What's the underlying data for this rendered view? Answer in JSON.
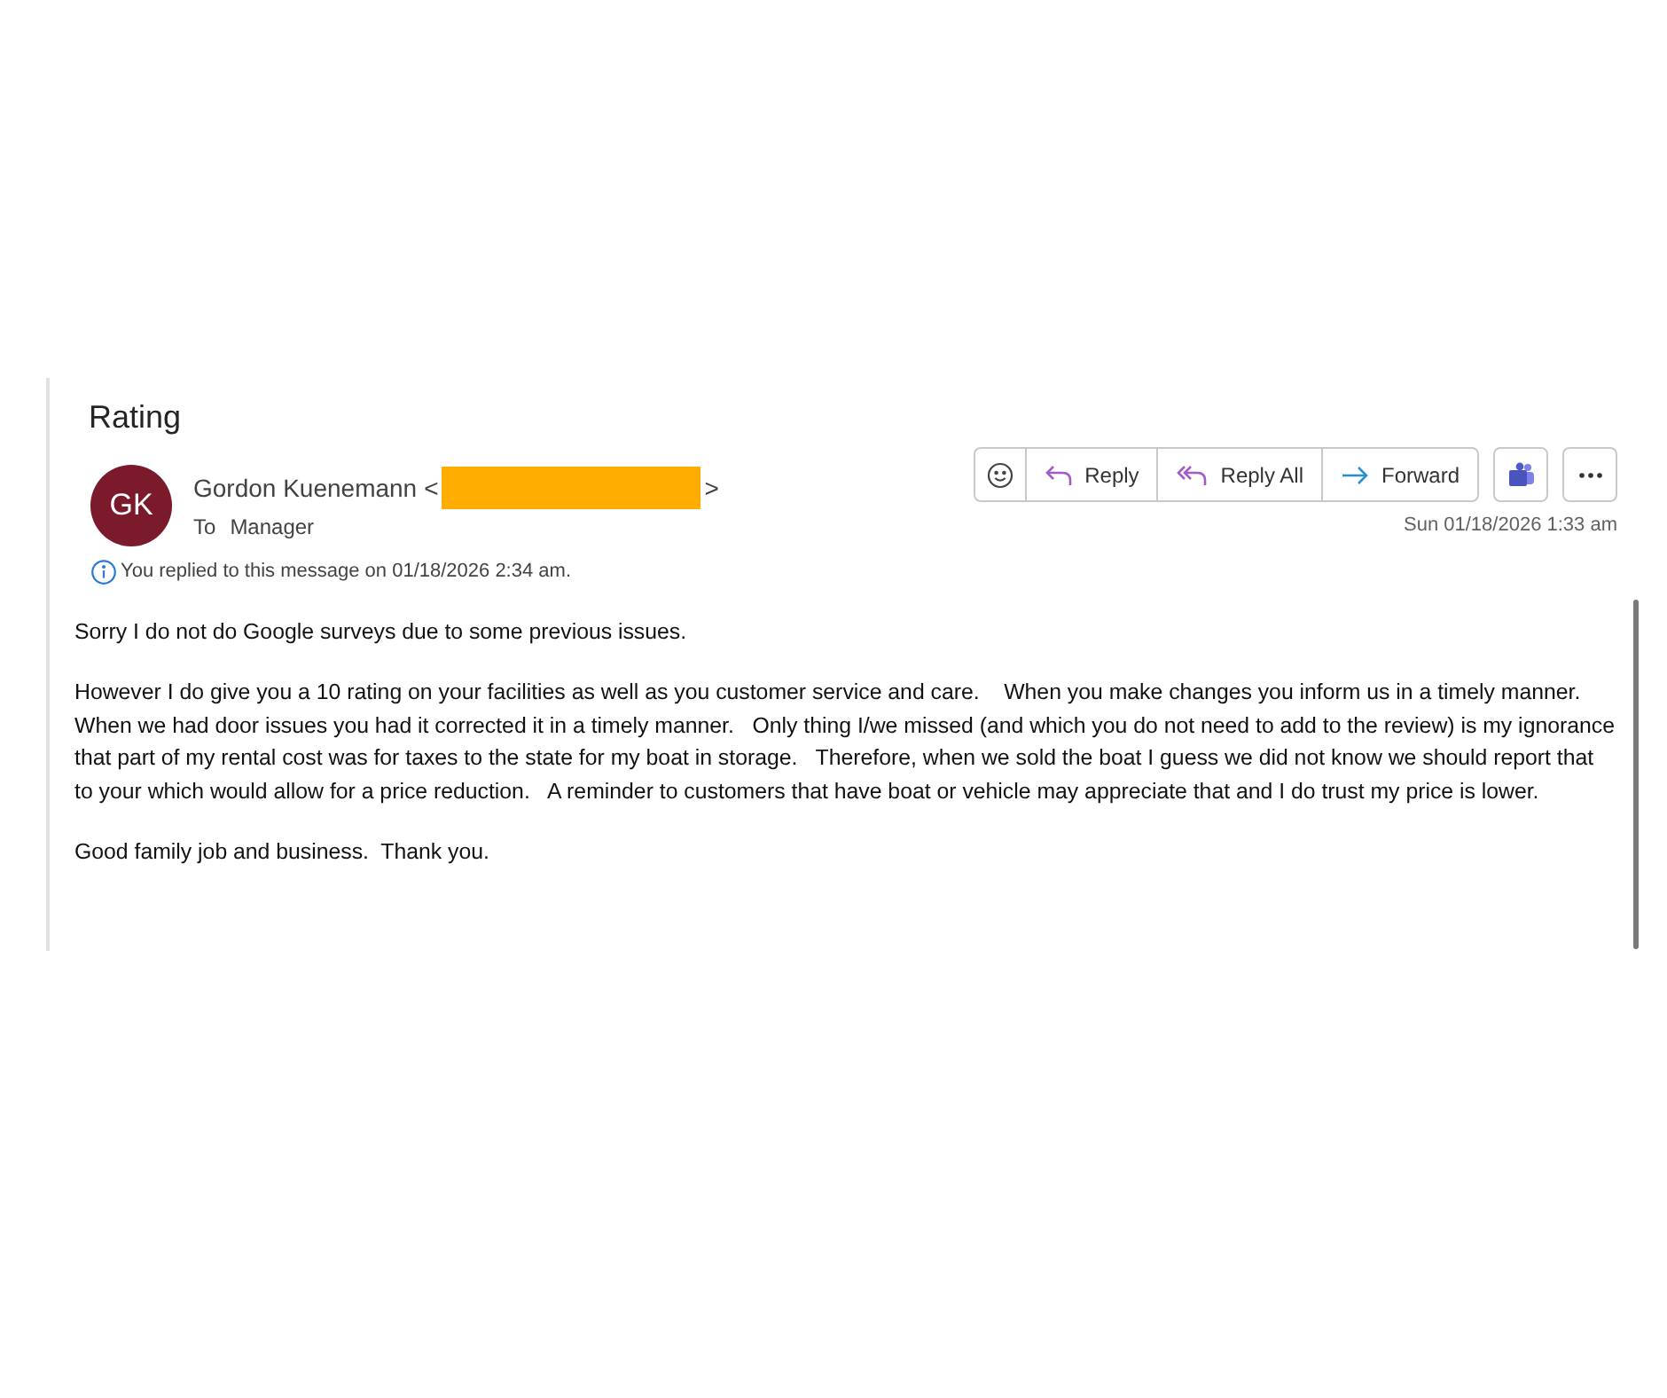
{
  "subject": "Rating",
  "sender": {
    "initials": "GK",
    "name": "Gordon Kuenemann",
    "open_bracket": "<",
    "close_bracket": ">",
    "address_redacted": true
  },
  "recipients": {
    "label": "To",
    "names": "Manager"
  },
  "info": "You replied to this message on 01/18/2026 2:34 am.",
  "actions": [
    {
      "kind": "emoji"
    },
    {
      "kind": "reply",
      "label": "Reply"
    },
    {
      "kind": "reply_all",
      "label": "Reply All"
    },
    {
      "kind": "forward",
      "label": "Forward"
    }
  ],
  "extra_buttons": [
    {
      "kind": "teams"
    },
    {
      "kind": "more"
    }
  ],
  "date": "Sun 01/18/2026 1:33 am",
  "body": [
    "Sorry I do not do Google surveys due to some previous issues.",
    "However I do give you a 10 rating on your facilities as well as you customer service and care.    When you make changes you inform us in a timely manner.  When we had door issues you had it corrected it in a timely manner.   Only thing I/we missed (and which you do not need to add to the review) is my ignorance that part of my rental cost was for taxes to the state for my boat in storage.   Therefore, when we sold the boat I guess we did not know we should report that to your which would allow for a price reduction.   A reminder to customers that have boat or vehicle may appreciate that and I do trust my price is lower.",
    "Good family job and business.  Thank you."
  ]
}
